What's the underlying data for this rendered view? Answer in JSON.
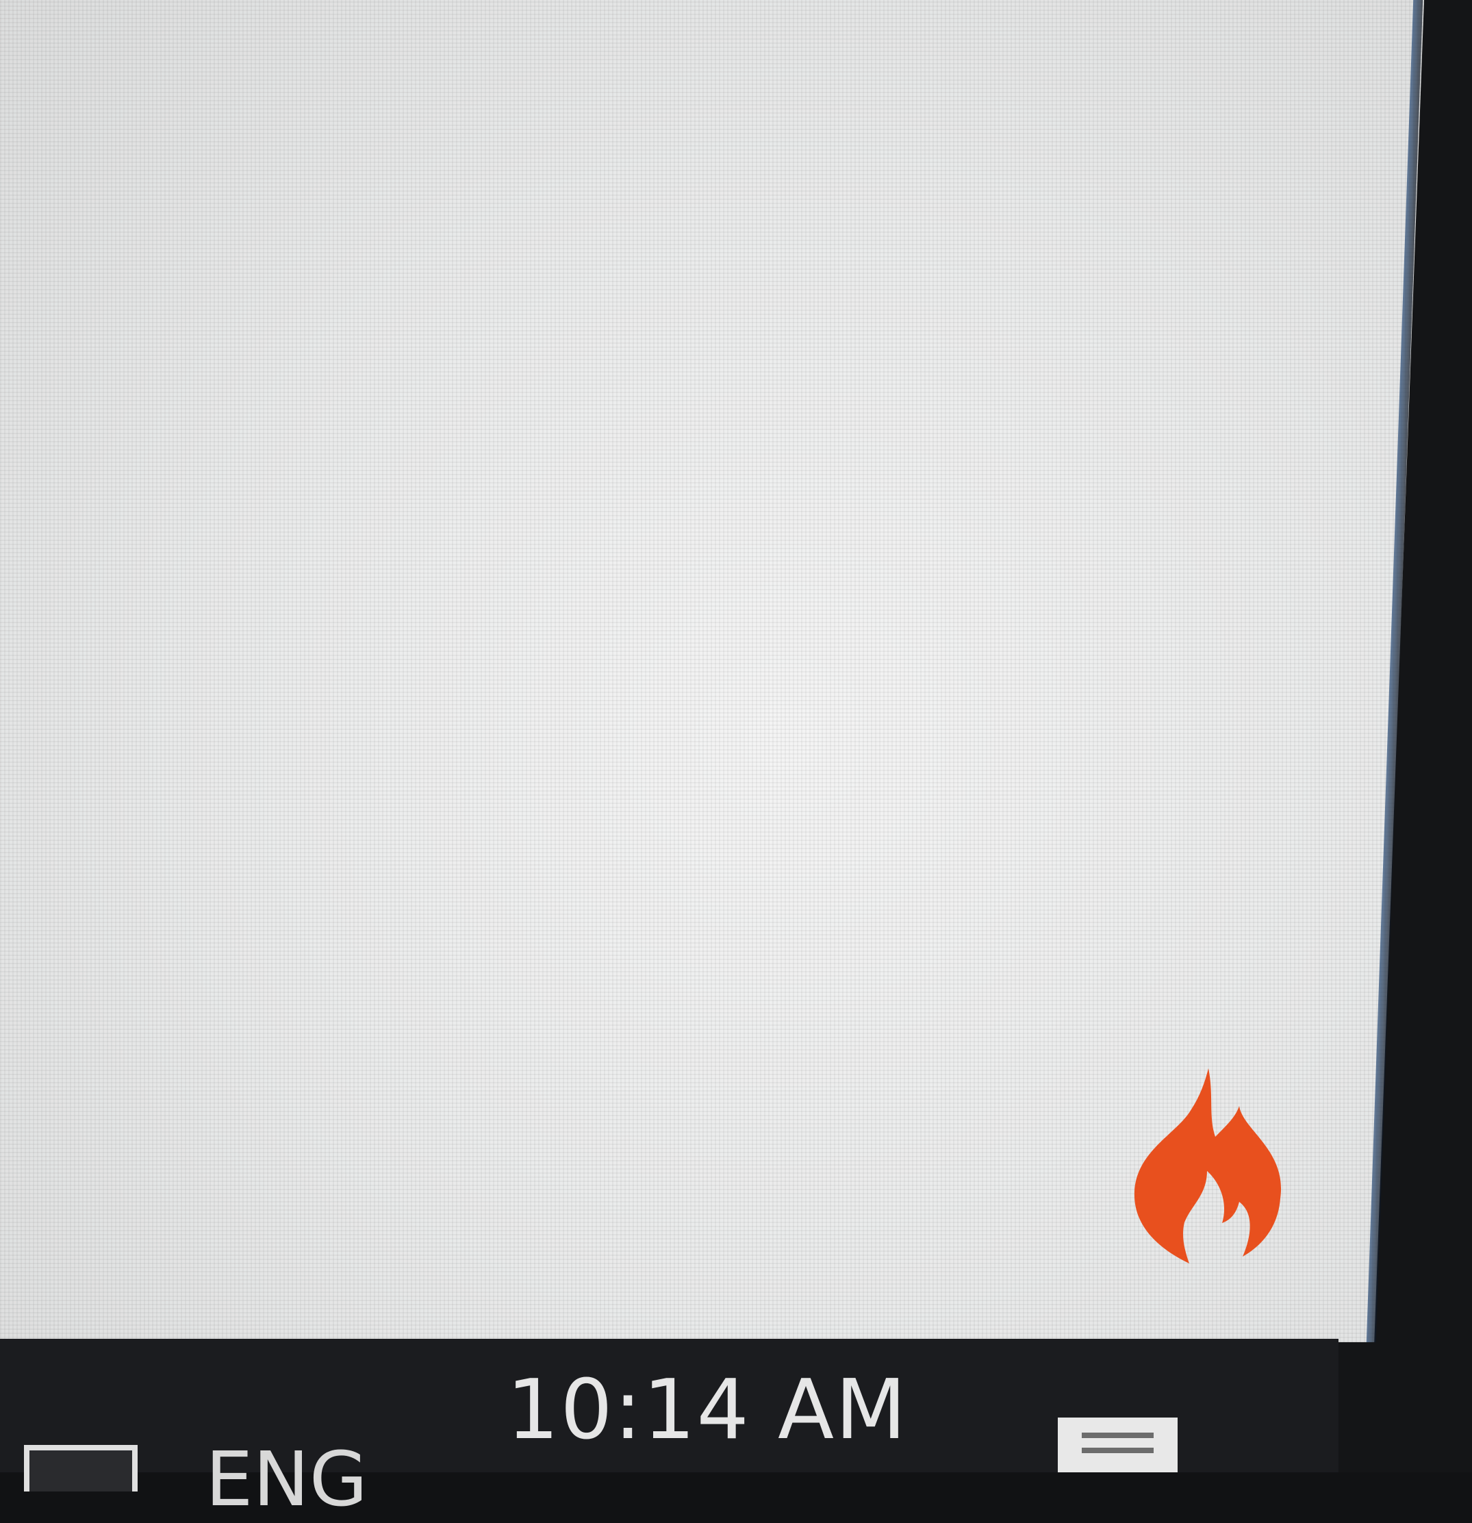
{
  "taskbar": {
    "clock_label": "10:14 AM",
    "language_label": "ENG"
  },
  "icons": {
    "tray_app": "flame-icon",
    "notification": "notification-icon",
    "task_view": "task-view-icon"
  },
  "colors": {
    "flame": "#e8501e",
    "taskbar": "#1b1c1f",
    "screen": "#ececec"
  }
}
